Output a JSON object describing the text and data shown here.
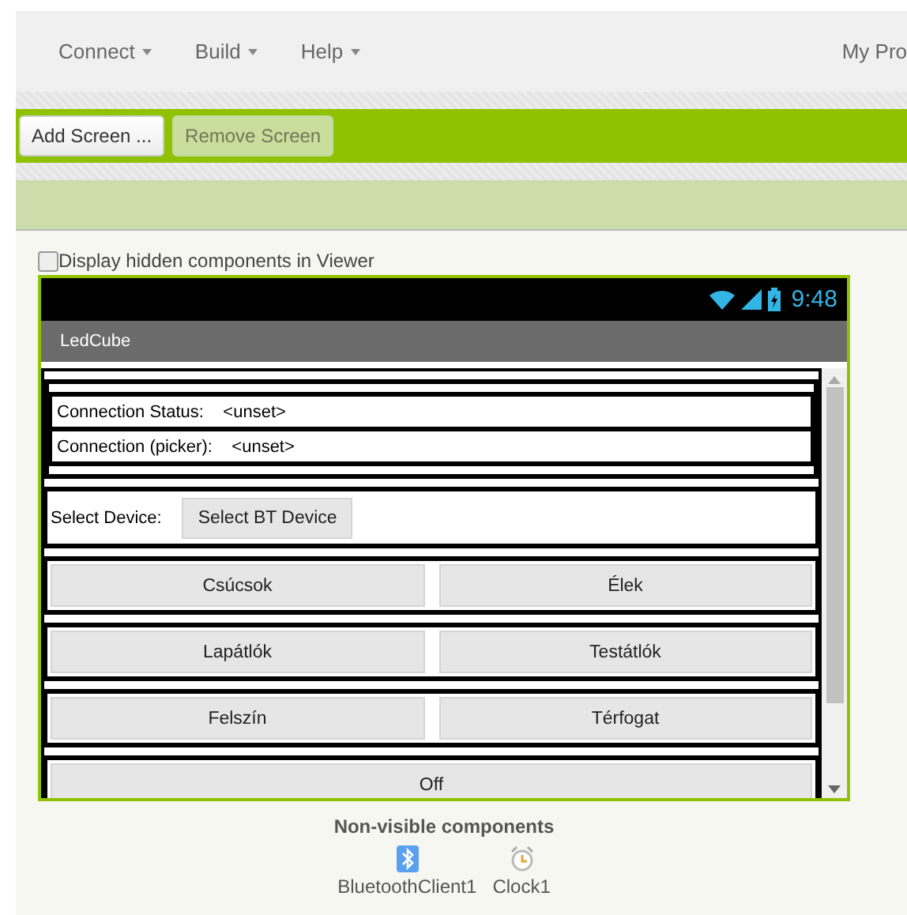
{
  "menu": [
    {
      "label": "Connect",
      "caret": true
    },
    {
      "label": "Build",
      "caret": true
    },
    {
      "label": "Help",
      "caret": true
    }
  ],
  "menu_right": "My Pro",
  "toolbar": [
    {
      "label": "Add Screen ...",
      "disabled": false
    },
    {
      "label": "Remove Screen",
      "disabled": true
    }
  ],
  "viewer_option": {
    "label": "Display hidden components in Viewer",
    "checked": false
  },
  "phone": {
    "time": "9:48",
    "title": "LedCube",
    "status_rows": [
      {
        "label": "Connection Status:",
        "value": "<unset>"
      },
      {
        "label": "Connection (picker):",
        "value": "<unset>"
      }
    ],
    "select_label": "Select Device:",
    "select_button": "Select BT Device",
    "button_rows": [
      [
        "Csúcsok",
        "Élek"
      ],
      [
        "Lapátlók",
        "Testátlók"
      ],
      [
        "Felszín",
        "Térfogat"
      ],
      [
        "Off"
      ]
    ]
  },
  "non_visible": {
    "title": "Non-visible components",
    "items": [
      {
        "kind": "bluetooth",
        "label": "BluetoothClient1"
      },
      {
        "kind": "clock",
        "label": "Clock1"
      }
    ]
  }
}
